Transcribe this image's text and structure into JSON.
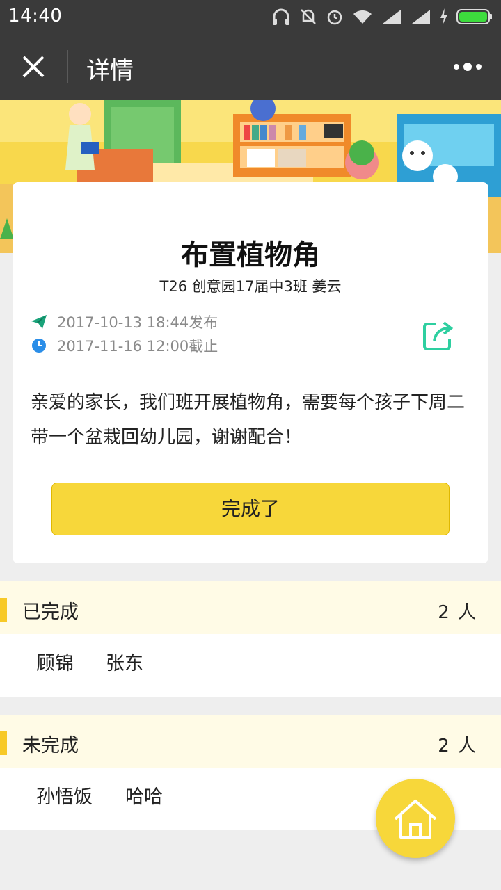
{
  "statusbar": {
    "time": "14:40",
    "icons": [
      "headphones-icon",
      "bell-off-icon",
      "alarm-icon",
      "wifi-icon",
      "signal-icon",
      "signal-icon-2",
      "charging-icon",
      "battery-icon"
    ]
  },
  "navbar": {
    "title": "详情",
    "close_icon": "close-icon",
    "more_icon": "more-dots-icon"
  },
  "task": {
    "title": "布置植物角",
    "meta": "T26 创意园17届中3班 姜云",
    "published": "2017-10-13 18:44发布",
    "deadline": "2017-11-16 12:00截止",
    "content": "亲爱的家长，我们班开展植物角，需要每个孩子下周二带一个盆栽回幼儿园，谢谢配合！",
    "done_button": "完成了",
    "share_icon": "share-icon"
  },
  "completed": {
    "label": "已完成",
    "count": "2 人",
    "names": [
      "顾锦",
      "张东"
    ]
  },
  "incomplete": {
    "label": "未完成",
    "count": "2 人",
    "names": [
      "孙悟饭",
      "哈哈"
    ]
  },
  "colors": {
    "accent": "#f7d73a",
    "navbar": "#3a3a3a",
    "section_head": "#fffbe6",
    "share_green": "#2ecfa0",
    "send_green": "#1aa37a",
    "clock_blue": "#2b8ee8"
  },
  "fab": {
    "icon": "home-icon"
  }
}
